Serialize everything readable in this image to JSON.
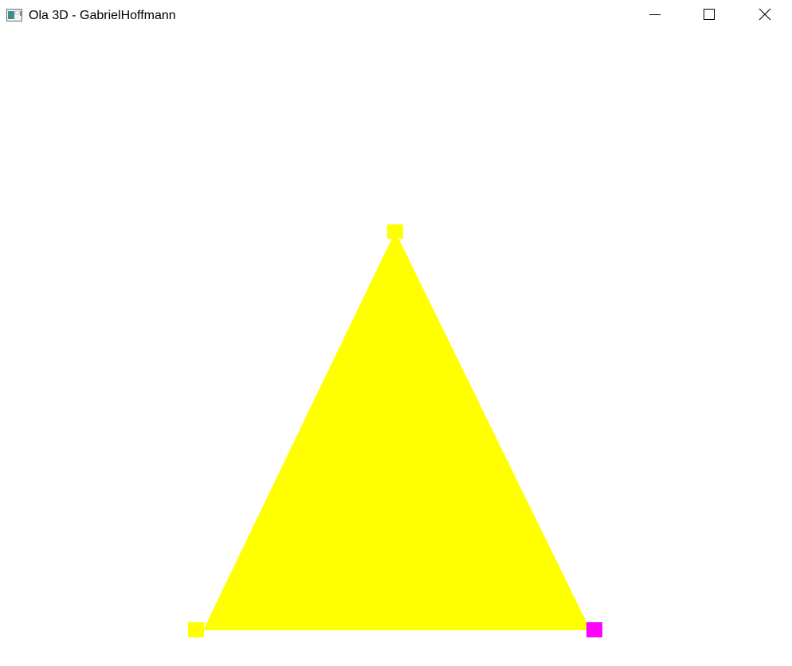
{
  "window": {
    "title": "Ola 3D - GabrielHoffmann",
    "controls": {
      "minimize": "minimize",
      "maximize": "maximize",
      "close": "close"
    }
  },
  "scene": {
    "background_color": "#ffffff",
    "triangle": {
      "fill_color": "#ffff00"
    },
    "vertex_markers": [
      {
        "name": "top",
        "color": "#ffff00"
      },
      {
        "name": "bottom-left",
        "color": "#ffff00"
      },
      {
        "name": "bottom-right",
        "color": "#ff00ff"
      }
    ]
  }
}
